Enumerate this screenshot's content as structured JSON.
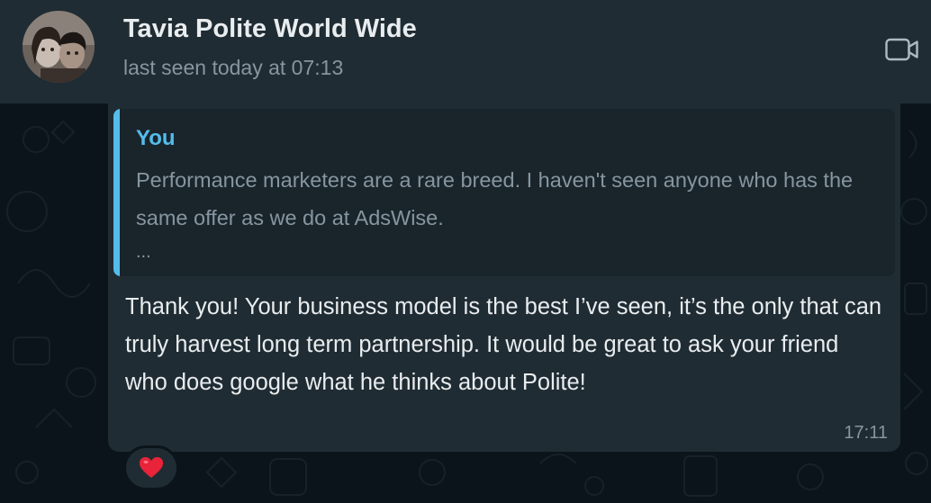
{
  "contact": {
    "name": "Tavia Polite World Wide",
    "status": "last seen today at 07:13"
  },
  "icons": {
    "video_call": "video-camera-icon",
    "reaction": "red-heart"
  },
  "message": {
    "quoted_author": "You",
    "quoted_text": "Performance marketers are a rare breed. I haven't seen anyone who has the same offer as we do at AdsWise.",
    "quoted_ellipsis": "...",
    "text": "Thank you! Your business model is the best I’ve seen, it’s the only that can truly harvest long term partnership. It would be great to ask your friend who does google what he thinks about Polite!",
    "time": "17:11"
  },
  "colors": {
    "header_bg": "#202c33",
    "chat_bg": "#0b141a",
    "bubble_bg": "#202c33",
    "quote_accent": "#53bdeb",
    "primary_text": "#e9edef",
    "secondary_text": "#8696a0",
    "reaction_heart": "#e8233a"
  }
}
